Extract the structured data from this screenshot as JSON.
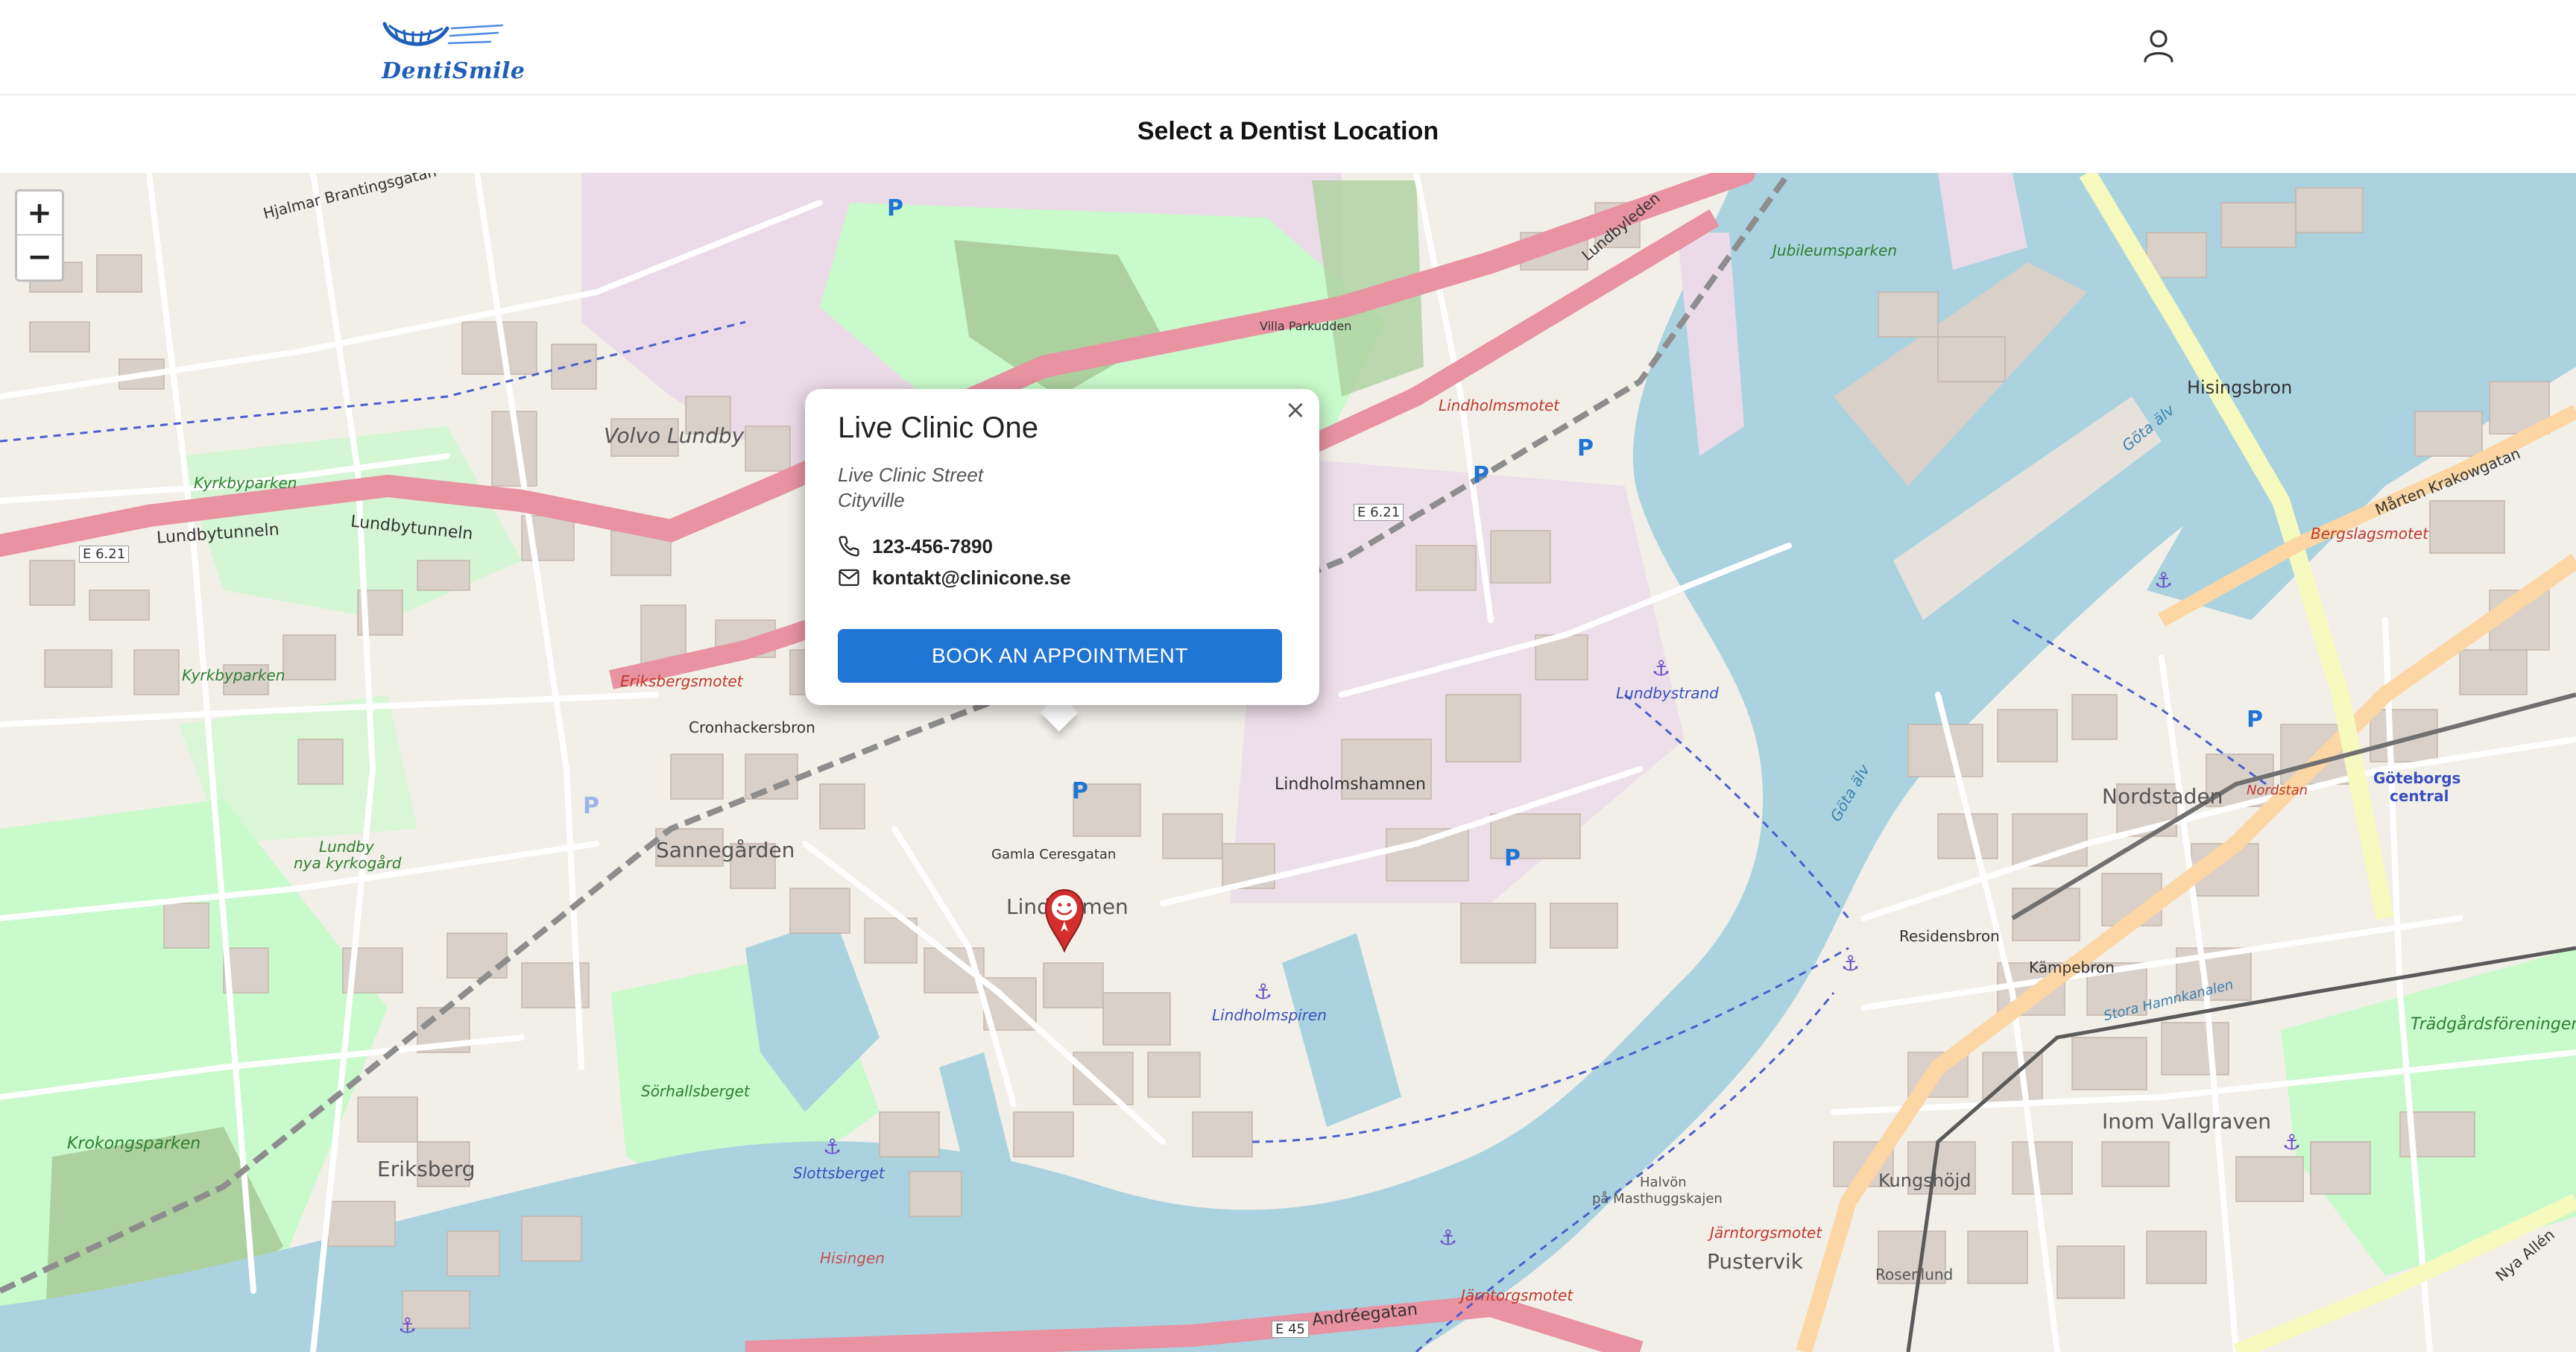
{
  "header": {
    "logo_text": "DentiSmile",
    "user_icon": "user-icon"
  },
  "page_title": "Select a Dentist Location",
  "map": {
    "zoom_in_label": "+",
    "zoom_out_label": "−",
    "labels": {
      "volvo_lundby": "Volvo Lundby",
      "sannegarden": "Sannegården",
      "lindholmen": "Lindholmen",
      "lindholmshamnen": "Lindholmshamnen",
      "nordstaden": "Nordstaden",
      "inom_vallgraven": "Inom Vallgraven",
      "eriksberg": "Eriksberg",
      "pustervik": "Pustervik",
      "hisingsbron": "Hisingsbron",
      "kyrkbyparken_1": "Kyrkbyparken",
      "kyrkbyparken_2": "Kyrkbyparken",
      "lundby_kyrkogard_1": "Lundby",
      "lundby_kyrkogard_2": "nya kyrkogård",
      "krokongsparken": "Krokongsparken",
      "sorhallsberget": "Sörhallsberget",
      "slottsberget": "Slottsberget",
      "lindholmspiren": "Lindholmspiren",
      "lundbystrand": "Lundbystrand",
      "kungshojd": "Kungshöjd",
      "rosenlund": "Rosenlund",
      "residensbron": "Residensbron",
      "kampebron": "Kämpebron",
      "tradgardsforeningen": "Trädgårdsföreningen",
      "goteborgs_central_1": "Göteborgs",
      "goteborgs_central_2": "central",
      "nordstan": "Nordstan",
      "lindholmsmotet": "Lindholmsmotet",
      "eriksbergsmotet": "Eriksbergsmotet",
      "bergslagsmotet": "Bergslagsmotet",
      "jarntorgsmotet_1": "Järntorgsmotet",
      "jarntorgsmotet_2": "Järntorgsmotet",
      "lundbyleden": "Lundbyleden",
      "lundbytunneln_1": "Lundbytunneln",
      "lundbytunneln_2": "Lundbytunneln",
      "hjalmar": "Hjalmar Brantingsgatan",
      "cronhackersbron": "Cronhackersbron",
      "gamla_ceresgatan": "Gamla Ceresgatan",
      "andreegatan": "Andréegatan",
      "e621_1": "E 6.21",
      "e621_2": "E 6.21",
      "e45": "E 45",
      "gota_alv_1": "Göta älv",
      "gota_alv_2": "Göta älv",
      "hisingen": "Hisingen",
      "jubileumsparken": "Jubileumsparken",
      "villa_parkudden": "Villa Parkudden",
      "marten_krakowgatan": "Mårten Krakowgatan",
      "nya_allen": "Nya Allén",
      "stora_hamnkanalen": "Stora Hamnkanalen",
      "halvon_1": "Halvön",
      "halvon_2": "på Masthuggskajen",
      "parking": "P"
    }
  },
  "popup": {
    "name": "Live Clinic One",
    "street": "Live Clinic Street",
    "city": "Cityville",
    "phone": "123-456-7890",
    "email": "kontakt@clinicone.se",
    "book_label": "BOOK AN APPOINTMENT",
    "close_label": "×",
    "phone_icon": "phone-icon",
    "email_icon": "mail-icon"
  },
  "colors": {
    "water": "#aad3df",
    "land": "#f2efe9",
    "park": "#c8facc",
    "wood": "#add19e",
    "industrial": "#ebdbe8",
    "building": "#d9d0c9",
    "motorway": "#e892a2",
    "primary_road": "#fcd6a4",
    "accent": "#1f74d4",
    "brand": "#1f5fb8",
    "marker": "#d32f2f"
  }
}
